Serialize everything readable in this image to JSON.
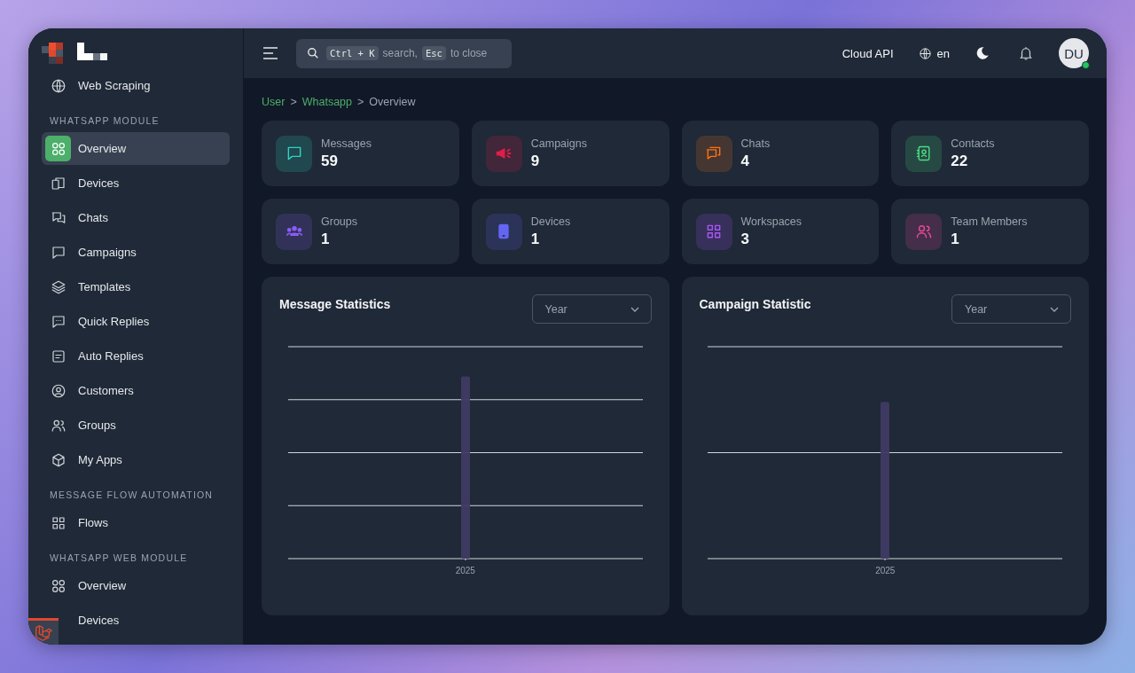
{
  "sidebar": {
    "sections": [
      {
        "items": [
          {
            "label": "Web Scraping",
            "selected": false
          }
        ]
      },
      {
        "heading": "WHATSAPP MODULE",
        "items": [
          {
            "label": "Overview",
            "selected": true
          },
          {
            "label": "Devices",
            "selected": false
          },
          {
            "label": "Chats",
            "selected": false
          },
          {
            "label": "Campaigns",
            "selected": false
          },
          {
            "label": "Templates",
            "selected": false
          },
          {
            "label": "Quick Replies",
            "selected": false
          },
          {
            "label": "Auto Replies",
            "selected": false
          },
          {
            "label": "Customers",
            "selected": false
          },
          {
            "label": "Groups",
            "selected": false
          },
          {
            "label": "My Apps",
            "selected": false
          }
        ]
      },
      {
        "heading": "MESSAGE FLOW AUTOMATION",
        "items": [
          {
            "label": "Flows",
            "selected": false
          }
        ]
      },
      {
        "heading": "WHATSAPP WEB MODULE",
        "items": [
          {
            "label": "Overview",
            "selected": false
          },
          {
            "label": "Devices",
            "selected": false
          }
        ]
      }
    ]
  },
  "header": {
    "search": [
      {
        "kind": "key",
        "text": "Ctrl + K"
      },
      {
        "kind": "text",
        "text": "search,"
      },
      {
        "kind": "key",
        "text": "Esc"
      },
      {
        "kind": "text",
        "text": "to close"
      }
    ],
    "api_label": "Cloud API",
    "language": "en",
    "avatar": "DU",
    "online": true
  },
  "breadcrumb": [
    {
      "label": "User",
      "link": true
    },
    {
      "label": "Whatsapp",
      "link": true
    },
    {
      "label": "Overview",
      "link": false
    }
  ],
  "breadcrumb_separator": ">",
  "stats": [
    {
      "label": "Messages",
      "value": "59",
      "color": "#2dd4bf"
    },
    {
      "label": "Campaigns",
      "value": "9",
      "color": "#e11d48"
    },
    {
      "label": "Chats",
      "value": "4",
      "color": "#f97316"
    },
    {
      "label": "Contacts",
      "value": "22",
      "color": "#4ade80"
    },
    {
      "label": "Groups",
      "value": "1",
      "color": "#8b5cf6"
    },
    {
      "label": "Devices",
      "value": "1",
      "color": "#6366f1"
    },
    {
      "label": "Workspaces",
      "value": "3",
      "color": "#a855f7"
    },
    {
      "label": "Team Members",
      "value": "1",
      "color": "#ec4899"
    }
  ],
  "charts": [
    {
      "title": "Message Statistics",
      "period": "Year",
      "category": "2025"
    },
    {
      "title": "Campaign Statistic",
      "period": "Year",
      "category": "2025"
    }
  ]
}
